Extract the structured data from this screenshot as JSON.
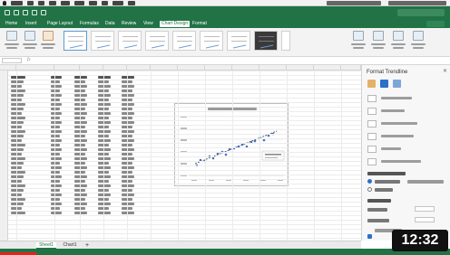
{
  "menu_bar": {
    "items": [
      "Excel",
      "File",
      "Edit",
      "View",
      "Insert",
      "Format",
      "Tools",
      "Data",
      "Window",
      "Help"
    ]
  },
  "title_bar": {
    "document_name": ""
  },
  "tabs": [
    {
      "label": "Home",
      "active": false
    },
    {
      "label": "Insert",
      "active": false
    },
    {
      "label": "Page Layout",
      "active": false
    },
    {
      "label": "Formulas",
      "active": false
    },
    {
      "label": "Data",
      "active": false
    },
    {
      "label": "Review",
      "active": false
    },
    {
      "label": "View",
      "active": false
    },
    {
      "label": "Chart Design",
      "active": true
    },
    {
      "label": "Format",
      "active": false
    }
  ],
  "format_pane": {
    "title": "Format Trendline",
    "close_glyph": "✕",
    "sections": {
      "name_radio_selected": "Automatic"
    }
  },
  "sheet_tabs": [
    {
      "label": "Sheet1",
      "active": true
    },
    {
      "label": "Chart1",
      "active": false
    }
  ],
  "video_timestamp": "12:32",
  "colors": {
    "excel_green": "#217346",
    "accent_blue": "#2b70c9",
    "progress_red": "#e1251b"
  }
}
